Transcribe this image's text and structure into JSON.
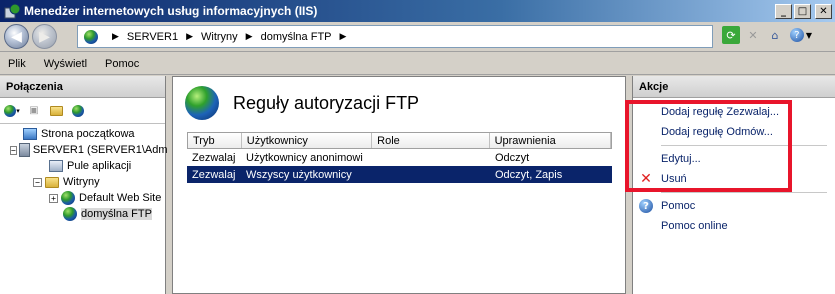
{
  "window": {
    "title": "Menedżer internetowych usług informacyjnych (IIS)"
  },
  "address": {
    "crumbs": [
      "SERVER1",
      "Witryny",
      "domyślna FTP"
    ]
  },
  "menu": {
    "file": "Plik",
    "view": "Wyświetl",
    "help": "Pomoc"
  },
  "connections": {
    "header": "Połączenia",
    "tree": [
      {
        "label": "Strona początkowa"
      },
      {
        "label": "SERVER1 (SERVER1\\Adm"
      },
      {
        "label": "Pule aplikacji"
      },
      {
        "label": "Witryny"
      },
      {
        "label": "Default Web Site"
      },
      {
        "label": "domyślna FTP"
      }
    ]
  },
  "main": {
    "title": "Reguły autoryzacji FTP",
    "columns": [
      "Tryb",
      "Użytkownicy",
      "Role",
      "Uprawnienia"
    ],
    "rows": [
      {
        "mode": "Zezwalaj",
        "users": "Użytkownicy anonimowi",
        "roles": "",
        "perms": "Odczyt"
      },
      {
        "mode": "Zezwalaj",
        "users": "Wszyscy użytkownicy",
        "roles": "",
        "perms": "Odczyt, Zapis"
      }
    ]
  },
  "actions": {
    "header": "Akcje",
    "add_allow": "Dodaj regułę Zezwalaj...",
    "add_deny": "Dodaj regułę Odmów...",
    "edit": "Edytuj...",
    "remove": "Usuń",
    "help": "Pomoc",
    "help_online": "Pomoc online"
  }
}
